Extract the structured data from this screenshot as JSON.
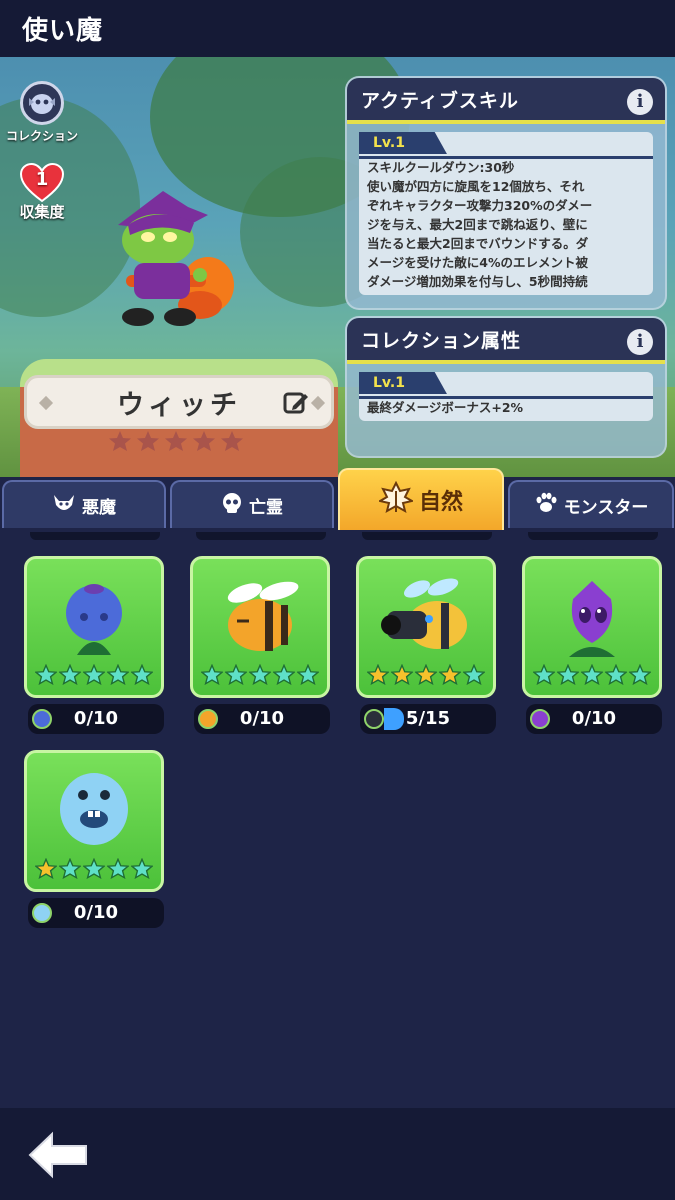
{
  "header": {
    "title": "使い魔"
  },
  "sidebar": {
    "collection_label": "コレクション",
    "collect_count": "1",
    "collect_label": "収集度"
  },
  "familiar": {
    "name": "ウィッチ",
    "stars_filled": 0,
    "stars_total": 5
  },
  "active_skill": {
    "title": "アクティブスキル",
    "info": "i",
    "level": "Lv.1",
    "lines": [
      "スキルクールダウン:30秒",
      "使い魔が四方に旋風を12個放ち、それ",
      "ぞれキャラクター攻撃力320%のダメー",
      "ジを与え、最大2回まで跳ね返り、壁に",
      "当たると最大2回までバウンドする。ダ",
      "メージを受けた敵に4%のエレメント被",
      "ダメージ増加効果を付与し、5秒間持続"
    ]
  },
  "collection_attr": {
    "title": "コレクション属性",
    "info": "i",
    "level": "Lv.1",
    "text": "最終ダメージボーナス+2%"
  },
  "tabs": [
    {
      "label": "悪魔",
      "icon": "demon-icon",
      "active": false
    },
    {
      "label": "亡霊",
      "icon": "skull-icon",
      "active": false
    },
    {
      "label": "自然",
      "icon": "leaf-icon",
      "active": true
    },
    {
      "label": "モンスター",
      "icon": "paw-icon",
      "active": false
    }
  ],
  "cards": [
    {
      "name": "blueberry-plant",
      "count": "0/10",
      "stars_gold": 0,
      "stars_total": 5,
      "progress": 0
    },
    {
      "name": "bee",
      "count": "0/10",
      "stars_gold": 0,
      "stars_total": 5,
      "progress": 0
    },
    {
      "name": "cannon-bee",
      "count": "5/15",
      "stars_gold": 4,
      "stars_total": 5,
      "progress": 0.33
    },
    {
      "name": "purple-bulb-plant",
      "count": "0/10",
      "stars_gold": 0,
      "stars_total": 5,
      "progress": 0
    },
    {
      "name": "blue-blob",
      "count": "0/10",
      "stars_gold": 1,
      "stars_total": 5,
      "progress": 0
    }
  ],
  "colors": {
    "card_green": "#4cc13a",
    "tab_active": "#f3a72a",
    "star_gold": "#f6c12c",
    "star_teal": "#5fe0c8",
    "progress_blue": "#3ea0ff"
  }
}
